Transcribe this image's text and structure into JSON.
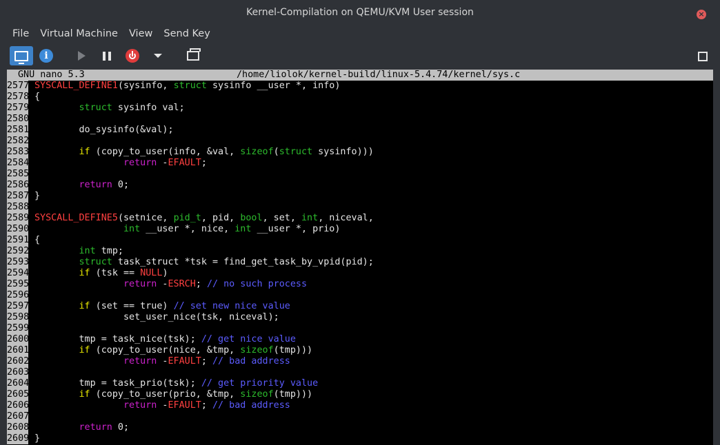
{
  "window": {
    "title": "Kernel-Compilation on QEMU/KVM User session",
    "close_glyph": "×"
  },
  "menu": {
    "items": [
      {
        "label": "File"
      },
      {
        "label": "Virtual Machine"
      },
      {
        "label": "View"
      },
      {
        "label": "Send Key"
      }
    ]
  },
  "toolbar": {
    "info_glyph": "i"
  },
  "nano": {
    "version": "GNU nano 5.3",
    "path": "/home/liolok/kernel-build/linux-5.4.74/kernel/sys.c"
  },
  "colors": {
    "keyword": "#e5e500",
    "type": "#2dbb2d",
    "define": "#ff4040",
    "return": "#cc22cc",
    "comment": "#5c5cff"
  },
  "code_lines": [
    {
      "num": "2577",
      "tokens": [
        [
          "d",
          "SYSCALL_DEFINE1"
        ],
        [
          "",
          "(sysinfo, "
        ],
        [
          "t",
          "struct"
        ],
        [
          "",
          " sysinfo __user *, info)"
        ]
      ]
    },
    {
      "num": "2578",
      "tokens": [
        [
          "",
          "{"
        ]
      ]
    },
    {
      "num": "2579",
      "tokens": [
        [
          "",
          "        "
        ],
        [
          "t",
          "struct"
        ],
        [
          "",
          " sysinfo val;"
        ]
      ]
    },
    {
      "num": "2580",
      "tokens": []
    },
    {
      "num": "2581",
      "tokens": [
        [
          "",
          "        do_sysinfo(&val);"
        ]
      ]
    },
    {
      "num": "2582",
      "tokens": []
    },
    {
      "num": "2583",
      "tokens": [
        [
          "",
          "        "
        ],
        [
          "k",
          "if"
        ],
        [
          "",
          " (copy_to_user(info, &val, "
        ],
        [
          "t",
          "sizeof"
        ],
        [
          "",
          "("
        ],
        [
          "t",
          "struct"
        ],
        [
          "",
          " sysinfo)))"
        ]
      ]
    },
    {
      "num": "2584",
      "tokens": [
        [
          "",
          "                "
        ],
        [
          "r",
          "return"
        ],
        [
          "",
          " -"
        ],
        [
          "d",
          "EFAULT"
        ],
        [
          "",
          ";"
        ]
      ]
    },
    {
      "num": "2585",
      "tokens": []
    },
    {
      "num": "2586",
      "tokens": [
        [
          "",
          "        "
        ],
        [
          "r",
          "return"
        ],
        [
          "",
          " 0;"
        ]
      ]
    },
    {
      "num": "2587",
      "tokens": [
        [
          "",
          "}"
        ]
      ]
    },
    {
      "num": "2588",
      "tokens": []
    },
    {
      "num": "2589",
      "tokens": [
        [
          "d",
          "SYSCALL_DEFINE5"
        ],
        [
          "",
          "(setnice, "
        ],
        [
          "t",
          "pid_t"
        ],
        [
          "",
          ", pid, "
        ],
        [
          "t",
          "bool"
        ],
        [
          "",
          ", set, "
        ],
        [
          "t",
          "int"
        ],
        [
          "",
          ", niceval,"
        ]
      ]
    },
    {
      "num": "2590",
      "tokens": [
        [
          "",
          "                "
        ],
        [
          "t",
          "int"
        ],
        [
          "",
          " __user *, nice, "
        ],
        [
          "t",
          "int"
        ],
        [
          "",
          " __user *, prio)"
        ]
      ]
    },
    {
      "num": "2591",
      "tokens": [
        [
          "",
          "{"
        ]
      ]
    },
    {
      "num": "2592",
      "tokens": [
        [
          "",
          "        "
        ],
        [
          "t",
          "int"
        ],
        [
          "",
          " tmp;"
        ]
      ]
    },
    {
      "num": "2593",
      "tokens": [
        [
          "",
          "        "
        ],
        [
          "t",
          "struct"
        ],
        [
          "",
          " task_struct *tsk = find_get_task_by_vpid(pid);"
        ]
      ]
    },
    {
      "num": "2594",
      "tokens": [
        [
          "",
          "        "
        ],
        [
          "k",
          "if"
        ],
        [
          "",
          " (tsk == "
        ],
        [
          "d",
          "NULL"
        ],
        [
          "",
          ")"
        ]
      ]
    },
    {
      "num": "2595",
      "tokens": [
        [
          "",
          "                "
        ],
        [
          "r",
          "return"
        ],
        [
          "",
          " -"
        ],
        [
          "d",
          "ESRCH"
        ],
        [
          "",
          "; "
        ],
        [
          "c",
          "// no such process"
        ]
      ]
    },
    {
      "num": "2596",
      "tokens": []
    },
    {
      "num": "2597",
      "tokens": [
        [
          "",
          "        "
        ],
        [
          "k",
          "if"
        ],
        [
          "",
          " (set == true) "
        ],
        [
          "c",
          "// set new nice value"
        ]
      ]
    },
    {
      "num": "2598",
      "tokens": [
        [
          "",
          "                set_user_nice(tsk, niceval);"
        ]
      ]
    },
    {
      "num": "2599",
      "tokens": []
    },
    {
      "num": "2600",
      "tokens": [
        [
          "",
          "        tmp = task_nice(tsk); "
        ],
        [
          "c",
          "// get nice value"
        ]
      ]
    },
    {
      "num": "2601",
      "tokens": [
        [
          "",
          "        "
        ],
        [
          "k",
          "if"
        ],
        [
          "",
          " (copy_to_user(nice, &tmp, "
        ],
        [
          "t",
          "sizeof"
        ],
        [
          "",
          "(tmp)))"
        ]
      ]
    },
    {
      "num": "2602",
      "tokens": [
        [
          "",
          "                "
        ],
        [
          "r",
          "return"
        ],
        [
          "",
          " -"
        ],
        [
          "d",
          "EFAULT"
        ],
        [
          "",
          "; "
        ],
        [
          "c",
          "// bad address"
        ]
      ]
    },
    {
      "num": "2603",
      "tokens": []
    },
    {
      "num": "2604",
      "tokens": [
        [
          "",
          "        tmp = task_prio(tsk); "
        ],
        [
          "c",
          "// get priority value"
        ]
      ]
    },
    {
      "num": "2605",
      "tokens": [
        [
          "",
          "        "
        ],
        [
          "k",
          "if"
        ],
        [
          "",
          " (copy_to_user(prio, &tmp, "
        ],
        [
          "t",
          "sizeof"
        ],
        [
          "",
          "(tmp)))"
        ]
      ]
    },
    {
      "num": "2606",
      "tokens": [
        [
          "",
          "                "
        ],
        [
          "r",
          "return"
        ],
        [
          "",
          " -"
        ],
        [
          "d",
          "EFAULT"
        ],
        [
          "",
          "; "
        ],
        [
          "c",
          "// bad address"
        ]
      ]
    },
    {
      "num": "2607",
      "tokens": []
    },
    {
      "num": "2608",
      "tokens": [
        [
          "",
          "        "
        ],
        [
          "r",
          "return"
        ],
        [
          "",
          " 0;"
        ]
      ]
    },
    {
      "num": "2609",
      "tokens": [
        [
          "",
          "}"
        ]
      ]
    }
  ]
}
